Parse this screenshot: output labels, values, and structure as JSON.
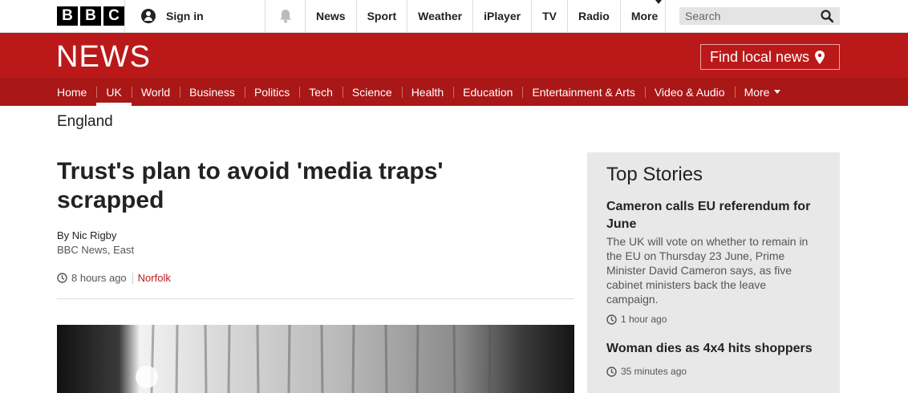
{
  "brand": {
    "letters": [
      "B",
      "B",
      "C"
    ]
  },
  "account": {
    "signin_label": "Sign in"
  },
  "topnav": {
    "items": [
      "News",
      "Sport",
      "Weather",
      "iPlayer",
      "TV",
      "Radio"
    ],
    "more_label": "More"
  },
  "search": {
    "placeholder": "Search"
  },
  "news": {
    "logo": "NEWS",
    "find_local_label": "Find local news"
  },
  "sections": {
    "items": [
      "Home",
      "UK",
      "World",
      "Business",
      "Politics",
      "Tech",
      "Science",
      "Health",
      "Education",
      "Entertainment & Arts",
      "Video & Audio"
    ],
    "more_label": "More",
    "active": "UK"
  },
  "region": "England",
  "article": {
    "headline": "Trust's plan to avoid 'media traps' scrapped",
    "author": "By Nic Rigby",
    "org": "BBC News, East",
    "time": "8 hours ago",
    "tag": "Norfolk"
  },
  "sidebar": {
    "title": "Top Stories",
    "stories": [
      {
        "title": "Cameron calls EU referendum for June",
        "summary": "The UK will vote on whether to remain in the EU on Thursday 23 June, Prime Minister David Cameron says, as five cabinet ministers back the leave campaign.",
        "time": "1 hour ago"
      },
      {
        "title": "Woman dies as 4x4 hits shoppers",
        "time": "35 minutes ago"
      }
    ]
  },
  "colors": {
    "brand_red": "#bb1919",
    "nav_red": "#a91717"
  }
}
